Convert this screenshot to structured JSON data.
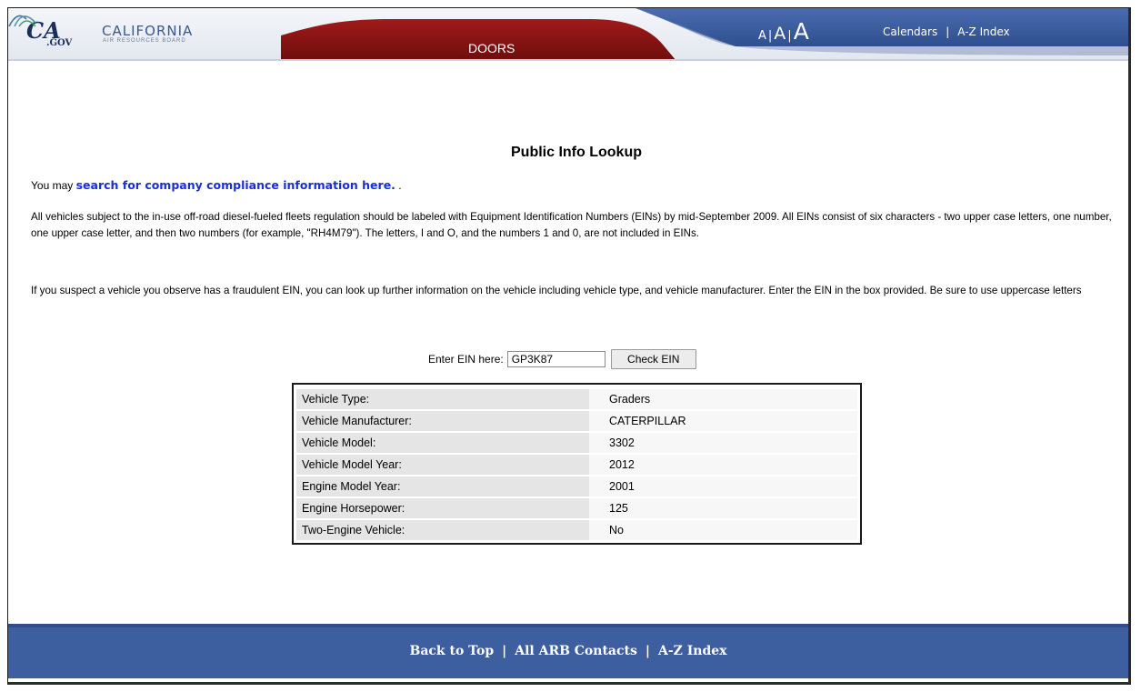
{
  "header": {
    "ca_logo": "CA",
    "ca_logo_suffix": ".GOV",
    "org_name": "CALIFORNIA",
    "org_sub": "AIR RESOURCES BOARD",
    "tab_label": "DOORS",
    "font_small": "A",
    "font_medium": "A",
    "font_large": "A",
    "font_sep": "|",
    "links": [
      "Calendars",
      "A-Z Index"
    ],
    "links_sep": "|"
  },
  "main": {
    "title": "Public Info Lookup",
    "intro_prefix": "You may ",
    "intro_link": "search for company compliance information here.",
    "intro_suffix": " .",
    "paragraph_1": "All vehicles subject to the in-use off-road diesel-fueled fleets regulation should be labeled with Equipment Identification Numbers (EINs) by mid-September 2009. All EINs consist of six characters - two upper case letters, one number, one upper case letter, and then two numbers (for example, \"RH4M79\"). The letters, I and O, and the numbers 1 and 0, are not included in EINs.",
    "paragraph_2": "If you suspect a vehicle you observe has a fraudulent EIN, you can look up further information on the vehicle including vehicle type, and vehicle manufacturer. Enter the EIN in the box provided. Be sure to use uppercase letters",
    "ein_label": "Enter EIN here:",
    "ein_value": "GP3K87",
    "check_button": "Check EIN",
    "results": [
      {
        "label": "Vehicle Type:",
        "value": "Graders"
      },
      {
        "label": "Vehicle Manufacturer:",
        "value": "CATERPILLAR"
      },
      {
        "label": "Vehicle Model:",
        "value": "3302"
      },
      {
        "label": "Vehicle Model Year:",
        "value": "2012"
      },
      {
        "label": "Engine Model Year:",
        "value": "2001"
      },
      {
        "label": "Engine Horsepower:",
        "value": "125"
      },
      {
        "label": "Two-Engine Vehicle:",
        "value": "No"
      }
    ]
  },
  "footer": {
    "links": [
      "Back to Top",
      "All ARB Contacts",
      "A-Z Index"
    ],
    "sep": "|"
  },
  "colors": {
    "header_blue": "#3d5fa0",
    "tab_red": "#8a1414",
    "link_blue": "#1a2ed6"
  }
}
